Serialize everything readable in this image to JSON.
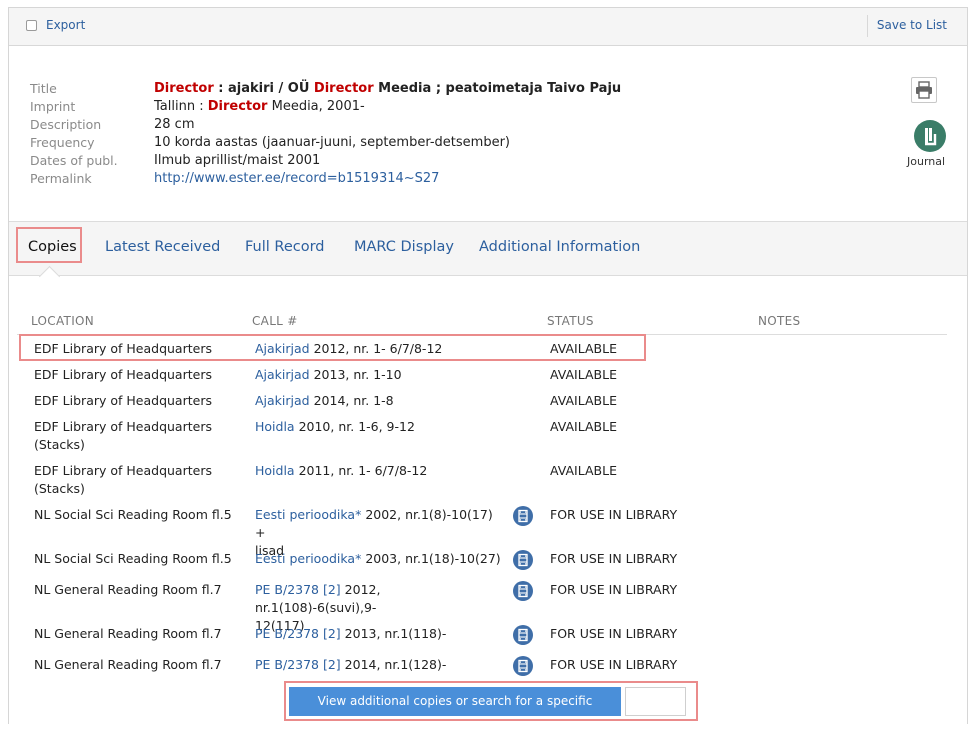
{
  "toolbar": {
    "export_label": "Export",
    "save_label": "Save to List"
  },
  "record": {
    "title_label": "Title",
    "title_parts": [
      "Director",
      " : ajakiri / OÜ ",
      "Director",
      " Meedia ; peatoimetaja Taivo Paju"
    ],
    "imprint_label": "Imprint",
    "imprint_parts": [
      "Tallinn : ",
      "Director",
      " Meedia, 2001-"
    ],
    "description_label": "Description",
    "description": "28 cm",
    "frequency_label": "Frequency",
    "frequency": "10 korda aastas (jaanuar-juuni, september-detsember)",
    "dates_label": "Dates of publ.",
    "dates": "Ilmub aprillist/maist 2001",
    "permalink_label": "Permalink",
    "permalink": "http://www.ester.ee/record=b1519314~S27",
    "format_label": "Journal"
  },
  "tabs": [
    "Copies",
    "Latest Received",
    "Full Record",
    "MARC Display",
    "Additional Information"
  ],
  "holdings": {
    "headers": [
      "LOCATION",
      "CALL #",
      "STATUS",
      "NOTES"
    ],
    "rows": [
      {
        "location": [
          "EDF Library of Headquarters"
        ],
        "call_link": "Ajakirjad",
        "call_rest": [
          "2012, nr. 1- 6/7/8-12"
        ],
        "status": "AVAILABLE"
      },
      {
        "location": [
          "EDF Library of Headquarters"
        ],
        "call_link": "Ajakirjad",
        "call_rest": [
          "2013, nr. 1-10"
        ],
        "status": "AVAILABLE"
      },
      {
        "location": [
          "EDF Library of Headquarters"
        ],
        "call_link": "Ajakirjad",
        "call_rest": [
          "2014, nr. 1-8"
        ],
        "status": "AVAILABLE"
      },
      {
        "location": [
          "EDF Library of Headquarters",
          "(Stacks)"
        ],
        "call_link": "Hoidla",
        "call_rest": [
          "2010, nr. 1-6, 9-12"
        ],
        "status": "AVAILABLE"
      },
      {
        "location": [
          "EDF Library of Headquarters",
          "(Stacks)"
        ],
        "call_link": "Hoidla",
        "call_rest": [
          "2011, nr. 1- 6/7/8-12"
        ],
        "status": "AVAILABLE"
      },
      {
        "location": [
          "NL Social Sci Reading Room fl.5"
        ],
        "call_link": "Eesti perioodika*",
        "call_rest": [
          "2002, nr.1(8)-10(17) +",
          "lisad"
        ],
        "status": "FOR USE IN LIBRARY"
      },
      {
        "location": [
          "NL Social Sci Reading Room fl.5"
        ],
        "call_link": "Eesti perioodika*",
        "call_rest": [
          "2003, nr.1(18)-10(27)"
        ],
        "status": "FOR USE IN LIBRARY"
      },
      {
        "location": [
          "NL General Reading Room fl.7"
        ],
        "call_link": "PE B/2378 [2]",
        "call_rest": [
          "2012, nr.1(108)-6(suvi),9-",
          "12(117)"
        ],
        "status": "FOR USE IN LIBRARY"
      },
      {
        "location": [
          "NL General Reading Room fl.7"
        ],
        "call_link": "PE B/2378 [2]",
        "call_rest": [
          "2013, nr.1(118)-"
        ],
        "status": "FOR USE IN LIBRARY"
      },
      {
        "location": [
          "NL General Reading Room fl.7"
        ],
        "call_link": "PE B/2378 [2]",
        "call_rest": [
          "2014, nr.1(128)-"
        ],
        "status": "FOR USE IN LIBRARY"
      }
    ]
  },
  "view_copies_label": "View additional copies or search for a specific volume/copy",
  "volume_input_value": ""
}
